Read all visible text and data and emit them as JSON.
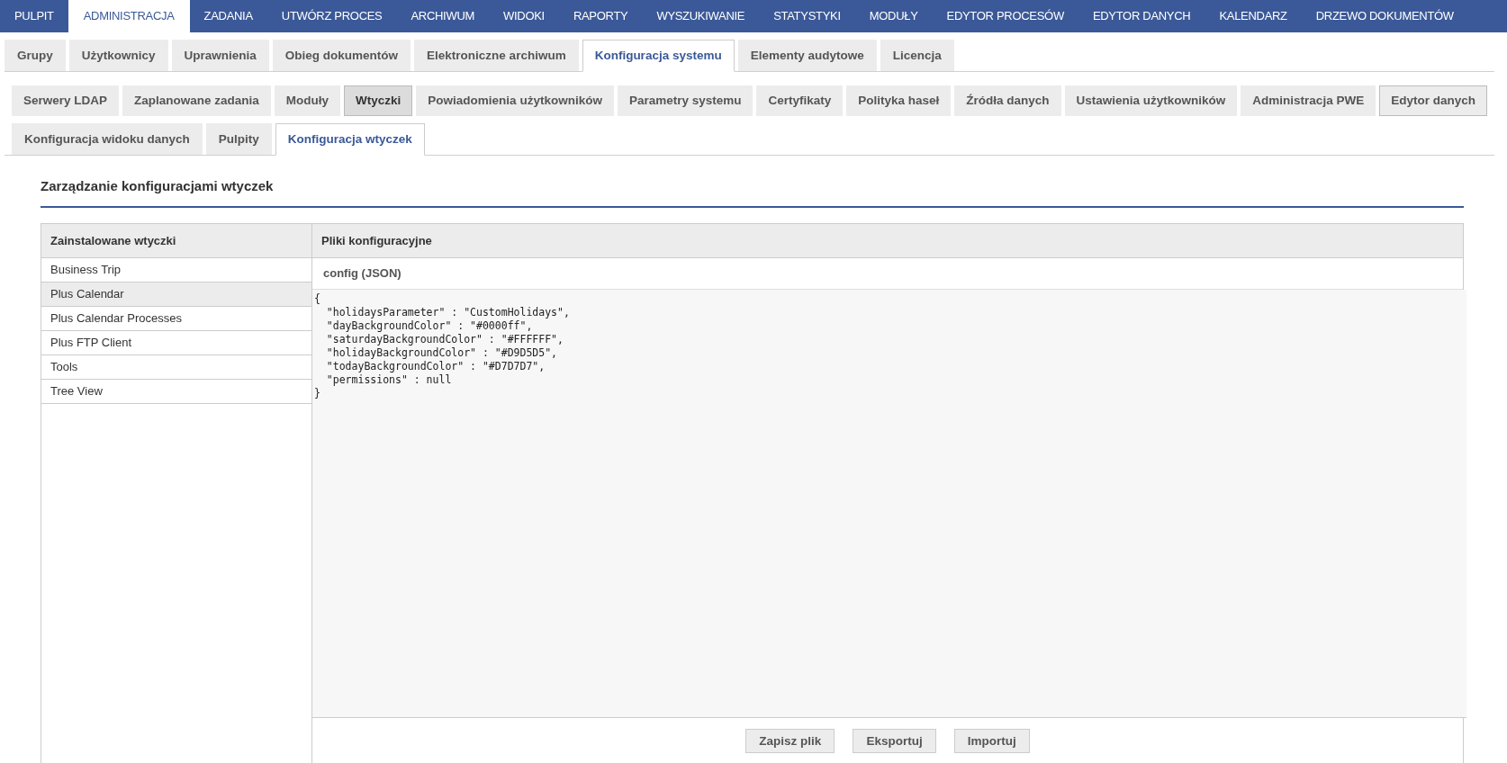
{
  "top_nav": [
    {
      "label": "PULPIT",
      "selected": false
    },
    {
      "label": "ADMINISTRACJA",
      "selected": true
    },
    {
      "label": "ZADANIA",
      "selected": false
    },
    {
      "label": "UTWÓRZ PROCES",
      "selected": false
    },
    {
      "label": "ARCHIWUM",
      "selected": false
    },
    {
      "label": "WIDOKI",
      "selected": false
    },
    {
      "label": "RAPORTY",
      "selected": false
    },
    {
      "label": "WYSZUKIWANIE",
      "selected": false
    },
    {
      "label": "STATYSTYKI",
      "selected": false
    },
    {
      "label": "MODUŁY",
      "selected": false
    },
    {
      "label": "EDYTOR PROCESÓW",
      "selected": false
    },
    {
      "label": "EDYTOR DANYCH",
      "selected": false
    },
    {
      "label": "KALENDARZ",
      "selected": false
    },
    {
      "label": "DRZEWO DOKUMENTÓW",
      "selected": false
    }
  ],
  "admin_tabs": [
    {
      "label": "Grupy",
      "selected": false
    },
    {
      "label": "Użytkownicy",
      "selected": false
    },
    {
      "label": "Uprawnienia",
      "selected": false
    },
    {
      "label": "Obieg dokumentów",
      "selected": false
    },
    {
      "label": "Elektroniczne archiwum",
      "selected": false
    },
    {
      "label": "Konfiguracja systemu",
      "selected": true
    },
    {
      "label": "Elementy audytowe",
      "selected": false
    },
    {
      "label": "Licencja",
      "selected": false
    }
  ],
  "system_tabs": [
    {
      "label": "Serwery LDAP",
      "selected": false,
      "focused": false
    },
    {
      "label": "Zaplanowane zadania",
      "selected": false,
      "focused": false
    },
    {
      "label": "Moduły",
      "selected": false,
      "focused": false
    },
    {
      "label": "Wtyczki",
      "selected": true,
      "focused": false
    },
    {
      "label": "Powiadomienia użytkowników",
      "selected": false,
      "focused": false
    },
    {
      "label": "Parametry systemu",
      "selected": false,
      "focused": false
    },
    {
      "label": "Certyfikaty",
      "selected": false,
      "focused": false
    },
    {
      "label": "Polityka haseł",
      "selected": false,
      "focused": false
    },
    {
      "label": "Źródła danych",
      "selected": false,
      "focused": false
    },
    {
      "label": "Ustawienia użytkowników",
      "selected": false,
      "focused": false
    },
    {
      "label": "Administracja PWE",
      "selected": false,
      "focused": false
    },
    {
      "label": "Edytor danych",
      "selected": false,
      "focused": true
    }
  ],
  "plugin_tabs": [
    {
      "label": "Konfiguracja widoku danych",
      "selected": false
    },
    {
      "label": "Pulpity",
      "selected": false
    },
    {
      "label": "Konfiguracja wtyczek",
      "selected": true
    }
  ],
  "heading": "Zarządzanie konfiguracjami wtyczek",
  "plugins": {
    "header": "Zainstalowane wtyczki",
    "items": [
      {
        "label": "Business Trip",
        "selected": false
      },
      {
        "label": "Plus Calendar",
        "selected": true
      },
      {
        "label": "Plus Calendar Processes",
        "selected": false
      },
      {
        "label": "Plus FTP Client",
        "selected": false
      },
      {
        "label": "Tools",
        "selected": false
      },
      {
        "label": "Tree View",
        "selected": false
      }
    ]
  },
  "config": {
    "header": "Pliki konfiguracyjne",
    "file": "config (JSON)",
    "code": "{\n  \"holidaysParameter\" : \"CustomHolidays\",\n  \"dayBackgroundColor\" : \"#0000ff\",\n  \"saturdayBackgroundColor\" : \"#FFFFFF\",\n  \"holidayBackgroundColor\" : \"#D9D5D5\",\n  \"todayBackgroundColor\" : \"#D7D7D7\",\n  \"permissions\" : null\n}",
    "buttons": [
      "Zapisz plik",
      "Eksportuj",
      "Importuj"
    ]
  }
}
